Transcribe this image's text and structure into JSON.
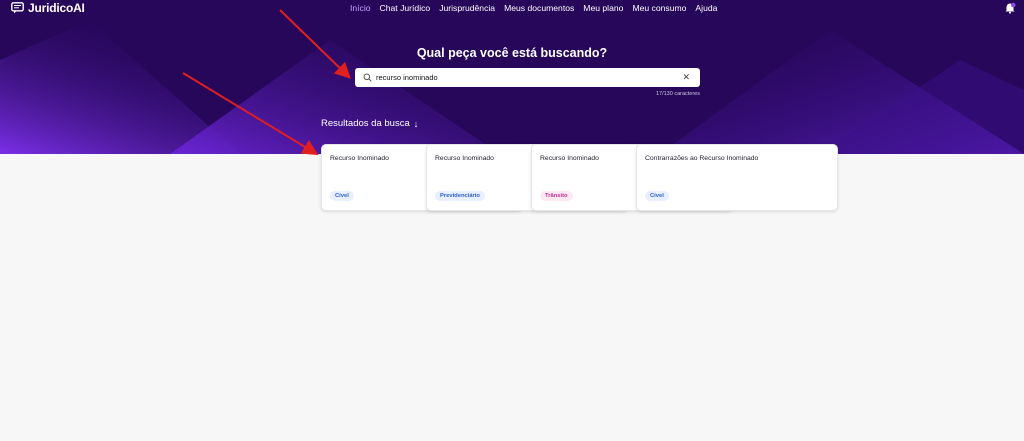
{
  "app": {
    "logo_text": "JuridicoAI"
  },
  "nav": [
    {
      "label": "Início",
      "active": true
    },
    {
      "label": "Chat Jurídico",
      "active": false
    },
    {
      "label": "Jurisprudência",
      "active": false
    },
    {
      "label": "Meus documentos",
      "active": false
    },
    {
      "label": "Meu plano",
      "active": false
    },
    {
      "label": "Meu consumo",
      "active": false
    },
    {
      "label": "Ajuda",
      "active": false
    }
  ],
  "hero": {
    "title": "Qual peça você está buscando?"
  },
  "search": {
    "value": "recurso inominado",
    "char_count": "17/130 caracteres"
  },
  "results": {
    "title": "Resultados da busca",
    "cards": [
      {
        "title": "Recurso Inominado",
        "badge": "Cível",
        "badge_color": "#2f5fd0",
        "badge_bg": "#e8efff"
      },
      {
        "title": "Recurso Inominado",
        "badge": "Previdenciário",
        "badge_color": "#2f5fd0",
        "badge_bg": "#e8efff"
      },
      {
        "title": "Recurso Inominado",
        "badge": "Trânsito",
        "badge_color": "#c4318f",
        "badge_bg": "#fde8f4"
      },
      {
        "title": "Contrarrazões ao Recurso Inominado",
        "badge": "Cível",
        "badge_color": "#2f5fd0",
        "badge_bg": "#e8efff"
      }
    ]
  },
  "colors": {
    "hero_bg": "#26075a",
    "accent": "#7a2ee0",
    "annotation_arrow": "#e01f1f"
  }
}
